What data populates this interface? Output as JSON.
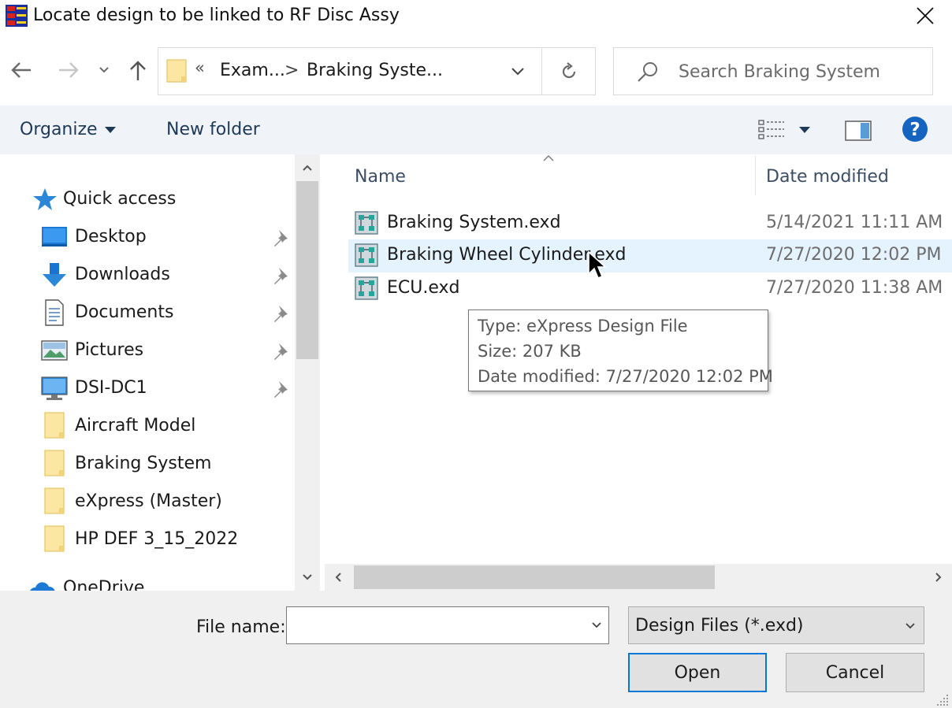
{
  "window": {
    "title": "Locate design to be linked to RF Disc Assy",
    "icons": {
      "app": "express-app-icon",
      "close": "close-icon"
    }
  },
  "navigation": {
    "breadcrumb_overflow": "«",
    "breadcrumbs": [
      "Exam...",
      "Braking Syste..."
    ],
    "separator": ">",
    "search_placeholder": "Search Braking System",
    "icons": [
      "back-arrow-icon",
      "forward-arrow-icon",
      "recent-locations-chevron-icon",
      "up-arrow-icon",
      "folder-icon",
      "chevron-down-icon",
      "refresh-icon",
      "search-icon"
    ]
  },
  "toolbar": {
    "organize_label": "Organize",
    "new_folder_label": "New folder",
    "icons": [
      "view-details-icon",
      "preview-pane-icon",
      "help-icon"
    ]
  },
  "sidebar": {
    "items": [
      {
        "label": "Quick access",
        "icon": "star-icon",
        "pinned": false
      },
      {
        "label": "Desktop",
        "icon": "desktop-icon",
        "pinned": true
      },
      {
        "label": "Downloads",
        "icon": "download-icon",
        "pinned": true
      },
      {
        "label": "Documents",
        "icon": "document-icon",
        "pinned": true
      },
      {
        "label": "Pictures",
        "icon": "pictures-icon",
        "pinned": true
      },
      {
        "label": "DSI-DC1",
        "icon": "computer-icon",
        "pinned": true
      },
      {
        "label": "Aircraft Model",
        "icon": "folder-icon",
        "pinned": false
      },
      {
        "label": "Braking System",
        "icon": "folder-icon",
        "pinned": false
      },
      {
        "label": "eXpress (Master)",
        "icon": "folder-icon",
        "pinned": false
      },
      {
        "label": "HP DEF 3_15_2022",
        "icon": "folder-icon",
        "pinned": false
      },
      {
        "label": "OneDrive",
        "icon": "cloud-icon",
        "pinned": false
      }
    ]
  },
  "files": {
    "columns": {
      "name": "Name",
      "date": "Date modified"
    },
    "rows": [
      {
        "name": "Braking System.exd",
        "date": "5/14/2021 11:11 AM"
      },
      {
        "name": "Braking Wheel Cylinder.exd",
        "date": "7/27/2020 12:02 PM"
      },
      {
        "name": "ECU.exd",
        "date": "7/27/2020 11:38 AM"
      }
    ]
  },
  "tooltip": {
    "type": "Type: eXpress Design File",
    "size": "Size: 207 KB",
    "date": "Date modified: 7/27/2020 12:02 PM"
  },
  "footer": {
    "file_name_label": "File name:",
    "file_name_value": "",
    "filter": "Design Files (*.exd)",
    "open_label": "Open",
    "cancel_label": "Cancel"
  },
  "colors": {
    "accent": "#0078d7",
    "hover_row": "#e5f3ff",
    "toolbar_bg": "#f0f4f9",
    "folder": "#fbe7a1"
  }
}
